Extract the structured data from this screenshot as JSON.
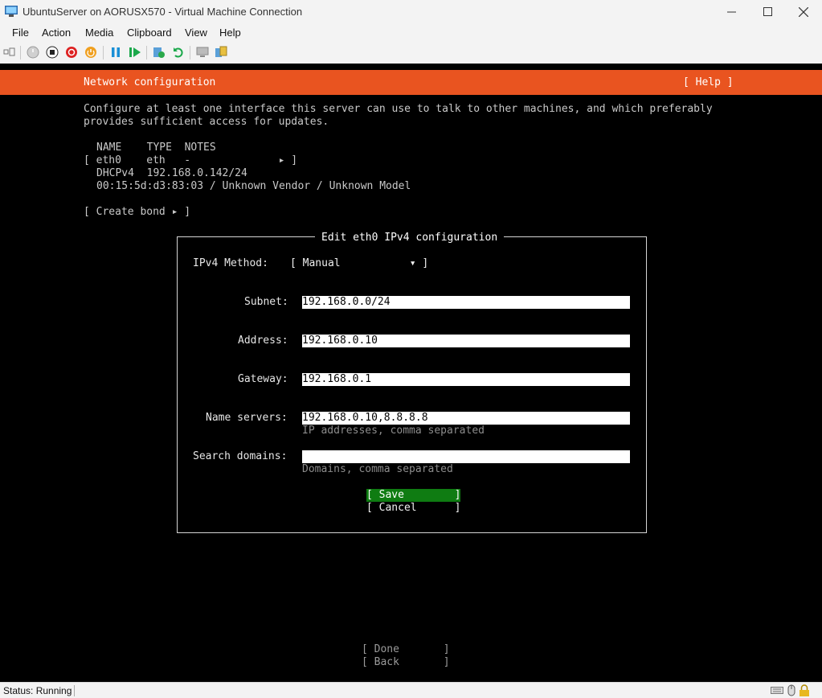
{
  "window": {
    "title": "UbuntuServer on AORUSX570 - Virtual Machine Connection",
    "minimize_glyph": "—",
    "maximize_glyph": "☐",
    "close_glyph": "✕"
  },
  "menu": {
    "items": [
      "File",
      "Action",
      "Media",
      "Clipboard",
      "View",
      "Help"
    ]
  },
  "toolbar": {
    "icons": [
      "ctrl-alt-del-icon",
      "start-icon",
      "turn-off-icon",
      "shutdown-icon",
      "save-state-icon",
      "pause-icon",
      "reset-icon",
      "checkpoint-icon",
      "revert-icon",
      "enhanced-session-icon",
      "share-icon"
    ]
  },
  "installer": {
    "header_title": "Network configuration",
    "help_label": "[ Help ]",
    "intro_line1": "Configure at least one interface this server can use to talk to other machines, and which preferably",
    "intro_line2": "provides sufficient access for updates.",
    "table_header": "NAME    TYPE  NOTES",
    "iface_row": "[ eth0    eth   -              ▸ ]",
    "iface_dhcp": "DHCPv4  192.168.0.142/24",
    "iface_mac": "00:15:5d:d3:83:03 / Unknown Vendor / Unknown Model",
    "create_bond": "[ Create bond ▸ ]",
    "done_label": "[ Done       ]",
    "back_label": "[ Back       ]"
  },
  "dialog": {
    "title": "Edit eth0 IPv4 configuration",
    "method_label": "IPv4 Method:",
    "method_value": "[ Manual           ▾ ]",
    "subnet_label": "Subnet:",
    "subnet_value": "192.168.0.0/24",
    "address_label": "Address:",
    "address_value": "192.168.0.10",
    "gateway_label": "Gateway:",
    "gateway_value": "192.168.0.1",
    "nameservers_label": "Name servers:",
    "nameservers_value": "192.168.0.10,8.8.8.8",
    "nameservers_hint": "IP addresses, comma separated",
    "search_label": "Search domains:",
    "search_value": "",
    "search_hint": "Domains, comma separated",
    "save_label": "[ Save        ]",
    "cancel_label": "[ Cancel      ]"
  },
  "status": {
    "text": "Status: Running"
  },
  "colors": {
    "ubuntu_orange": "#e95420",
    "save_green": "#0f7c12",
    "terminal_bg": "#000000"
  }
}
